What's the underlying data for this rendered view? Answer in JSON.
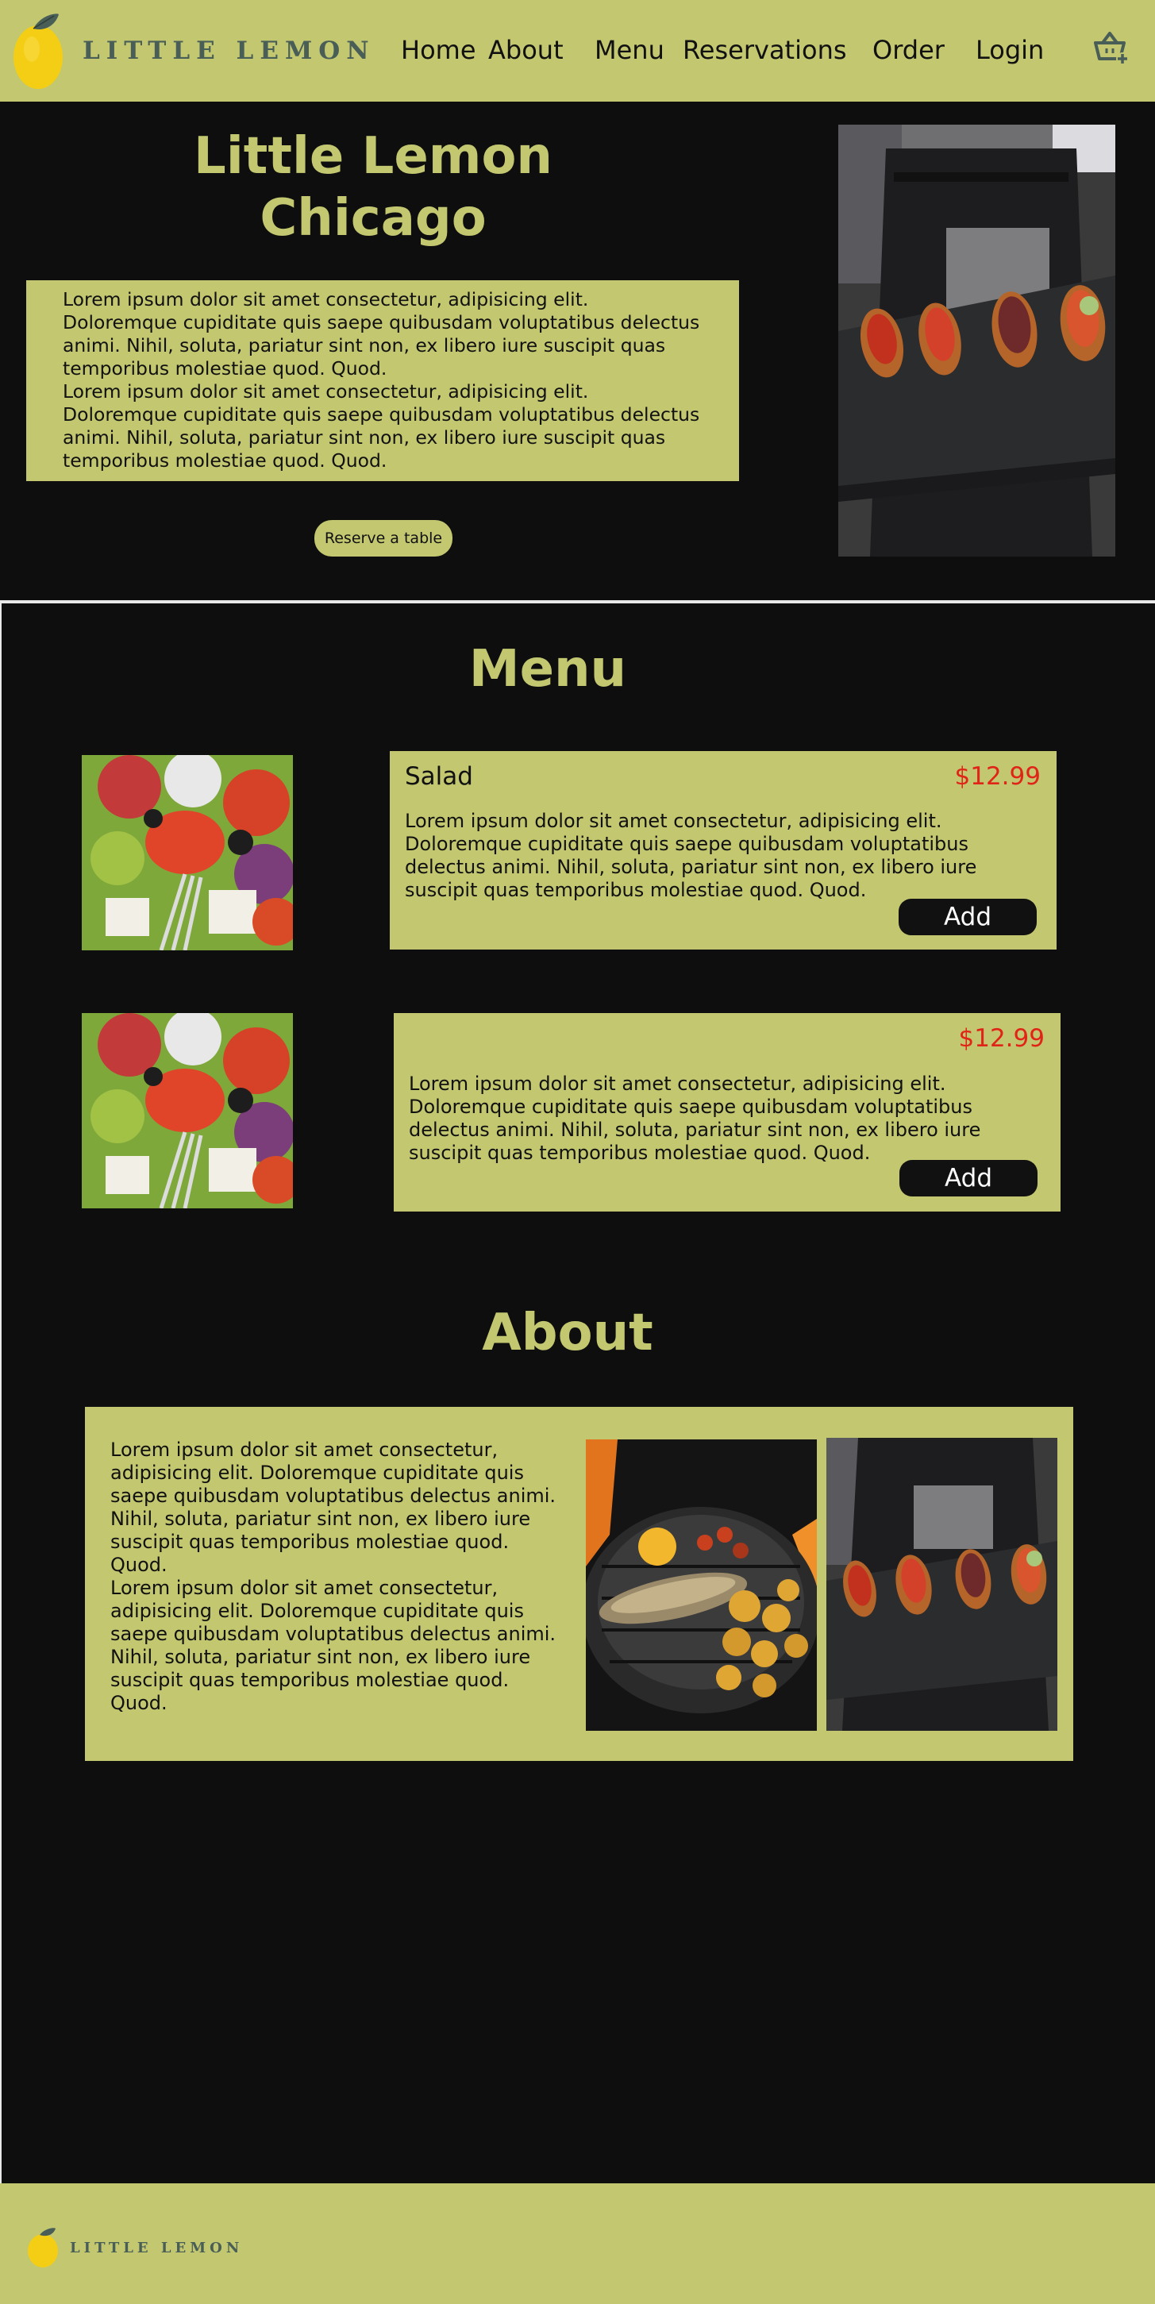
{
  "brand": {
    "name": "LITTLE LEMON"
  },
  "nav": {
    "items": [
      {
        "label": "Home"
      },
      {
        "label": "About"
      },
      {
        "label": "Menu"
      },
      {
        "label": "Reservations"
      },
      {
        "label": "Order"
      },
      {
        "label": "Login"
      }
    ],
    "basket_icon": "basket-add-icon"
  },
  "hero": {
    "title_line1": "Little Lemon",
    "title_line2": "Chicago",
    "paragraph1": "Lorem ipsum dolor sit amet consectetur, adipisicing elit. Doloremque cupiditate quis saepe quibusdam voluptatibus delectus animi. Nihil, soluta, pariatur sint non, ex libero iure suscipit quas temporibus molestiae quod. Quod.",
    "paragraph2": "Lorem ipsum dolor sit amet consectetur, adipisicing elit. Doloremque cupiditate quis saepe quibusdam voluptatibus delectus animi. Nihil, soluta, pariatur sint non, ex libero iure suscipit quas temporibus molestiae quod. Quod.",
    "reserve_label": "Reserve a table"
  },
  "menu": {
    "title": "Menu",
    "items": [
      {
        "name": "Salad",
        "price": "$12.99",
        "description": "Lorem ipsum dolor sit amet consectetur, adipisicing elit. Doloremque cupiditate quis saepe quibusdam voluptatibus delectus animi. Nihil, soluta, pariatur sint non, ex libero iure suscipit quas temporibus molestiae quod. Quod.",
        "add_label": "Add"
      },
      {
        "name": "",
        "price": "$12.99",
        "description": "Lorem ipsum dolor sit amet consectetur, adipisicing elit. Doloremque cupiditate quis saepe quibusdam voluptatibus delectus animi. Nihil, soluta, pariatur sint non, ex libero iure suscipit quas temporibus molestiae quod. Quod.",
        "add_label": "Add"
      }
    ]
  },
  "about": {
    "title": "About",
    "paragraph1": "Lorem ipsum dolor sit amet consectetur, adipisicing elit. Doloremque cupiditate quis saepe quibusdam voluptatibus delectus animi. Nihil, soluta, pariatur sint non, ex libero iure suscipit quas temporibus molestiae quod. Quod.",
    "paragraph2": "Lorem ipsum dolor sit amet consectetur, adipisicing elit. Doloremque cupiditate quis saepe quibusdam voluptatibus delectus animi. Nihil, soluta, pariatur sint non, ex libero iure suscipit quas temporibus molestiae quod. Quod."
  },
  "footer": {
    "brand": "LITTLE LEMON"
  },
  "colors": {
    "brand_green": "#c2c770",
    "background": "#0e0e0e",
    "price_red": "#e02418",
    "logo_text": "#495e57",
    "lemon_yellow": "#f4ce14"
  }
}
